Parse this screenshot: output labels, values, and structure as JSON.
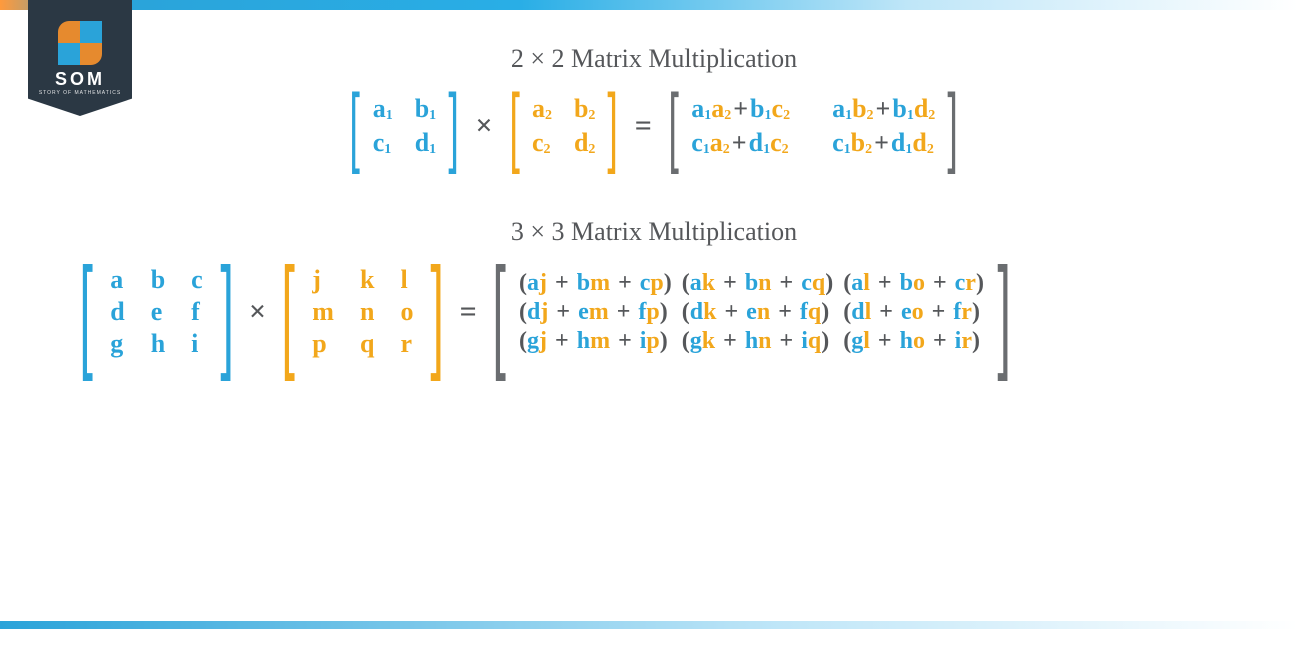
{
  "logo": {
    "text": "SOM",
    "sub": "STORY OF MATHEMATICS"
  },
  "section2": {
    "title": "2 × 2 Matrix Multiplication",
    "A": {
      "a11": "a",
      "a11s": "1",
      "a12": "b",
      "a12s": "1",
      "a21": "c",
      "a21s": "1",
      "a22": "d",
      "a22s": "1"
    },
    "B": {
      "b11": "a",
      "b11s": "2",
      "b12": "b",
      "b12s": "2",
      "b21": "c",
      "b21s": "2",
      "b22": "d",
      "b22s": "2"
    },
    "R": {
      "r11_t1a": "a",
      "r11_t1as": "1",
      "r11_t1b": "a",
      "r11_t1bs": "2",
      "r11_t2a": "b",
      "r11_t2as": "1",
      "r11_t2b": "c",
      "r11_t2bs": "2",
      "r12_t1a": "a",
      "r12_t1as": "1",
      "r12_t1b": "b",
      "r12_t1bs": "2",
      "r12_t2a": "b",
      "r12_t2as": "1",
      "r12_t2b": "d",
      "r12_t2bs": "2",
      "r21_t1a": "c",
      "r21_t1as": "1",
      "r21_t1b": "a",
      "r21_t1bs": "2",
      "r21_t2a": "d",
      "r21_t2as": "1",
      "r21_t2b": "c",
      "r21_t2bs": "2",
      "r22_t1a": "c",
      "r22_t1as": "1",
      "r22_t1b": "b",
      "r22_t1bs": "2",
      "r22_t2a": "d",
      "r22_t2as": "1",
      "r22_t2b": "d",
      "r22_t2bs": "2"
    },
    "ops": {
      "times": "×",
      "equals": "=",
      "plus": "+"
    }
  },
  "section3": {
    "title": "3 × 3 Matrix Multiplication",
    "A": [
      "a",
      "b",
      "c",
      "d",
      "e",
      "f",
      "g",
      "h",
      "i"
    ],
    "B": [
      "j",
      "k",
      "l",
      "m",
      "n",
      "o",
      "p",
      "q",
      "r"
    ],
    "R": [
      {
        "p": "(",
        "t": [
          [
            "a",
            "j"
          ],
          [
            "b",
            "m"
          ],
          [
            "c",
            "p"
          ]
        ],
        "s": ")"
      },
      {
        "p": "(",
        "t": [
          [
            "a",
            "k"
          ],
          [
            "b",
            "n"
          ],
          [
            "c",
            "q"
          ]
        ],
        "s": ")"
      },
      {
        "p": "(",
        "t": [
          [
            "a",
            "l"
          ],
          [
            "b",
            "o"
          ],
          [
            "c",
            "r"
          ]
        ],
        "s": ")"
      },
      {
        "p": "(",
        "t": [
          [
            "d",
            "j"
          ],
          [
            "e",
            "m"
          ],
          [
            "f",
            "p"
          ]
        ],
        "s": ")"
      },
      {
        "p": "(",
        "t": [
          [
            "d",
            "k"
          ],
          [
            "e",
            "n"
          ],
          [
            "f",
            "q"
          ]
        ],
        "s": ")"
      },
      {
        "p": "(",
        "t": [
          [
            "d",
            "l"
          ],
          [
            "e",
            "o"
          ],
          [
            "f",
            "r"
          ]
        ],
        "s": ")"
      },
      {
        "p": "(",
        "t": [
          [
            "g",
            "j"
          ],
          [
            "h",
            "m"
          ],
          [
            "i",
            "p"
          ]
        ],
        "s": ")"
      },
      {
        "p": "(",
        "t": [
          [
            "g",
            "k"
          ],
          [
            "h",
            "n"
          ],
          [
            "i",
            "q"
          ]
        ],
        "s": ")"
      },
      {
        "p": "(",
        "t": [
          [
            "g",
            "l"
          ],
          [
            "h",
            "o"
          ],
          [
            "i",
            "r"
          ]
        ],
        "s": ")"
      }
    ],
    "ops": {
      "times": "×",
      "equals": "=",
      "plus": " + "
    }
  }
}
